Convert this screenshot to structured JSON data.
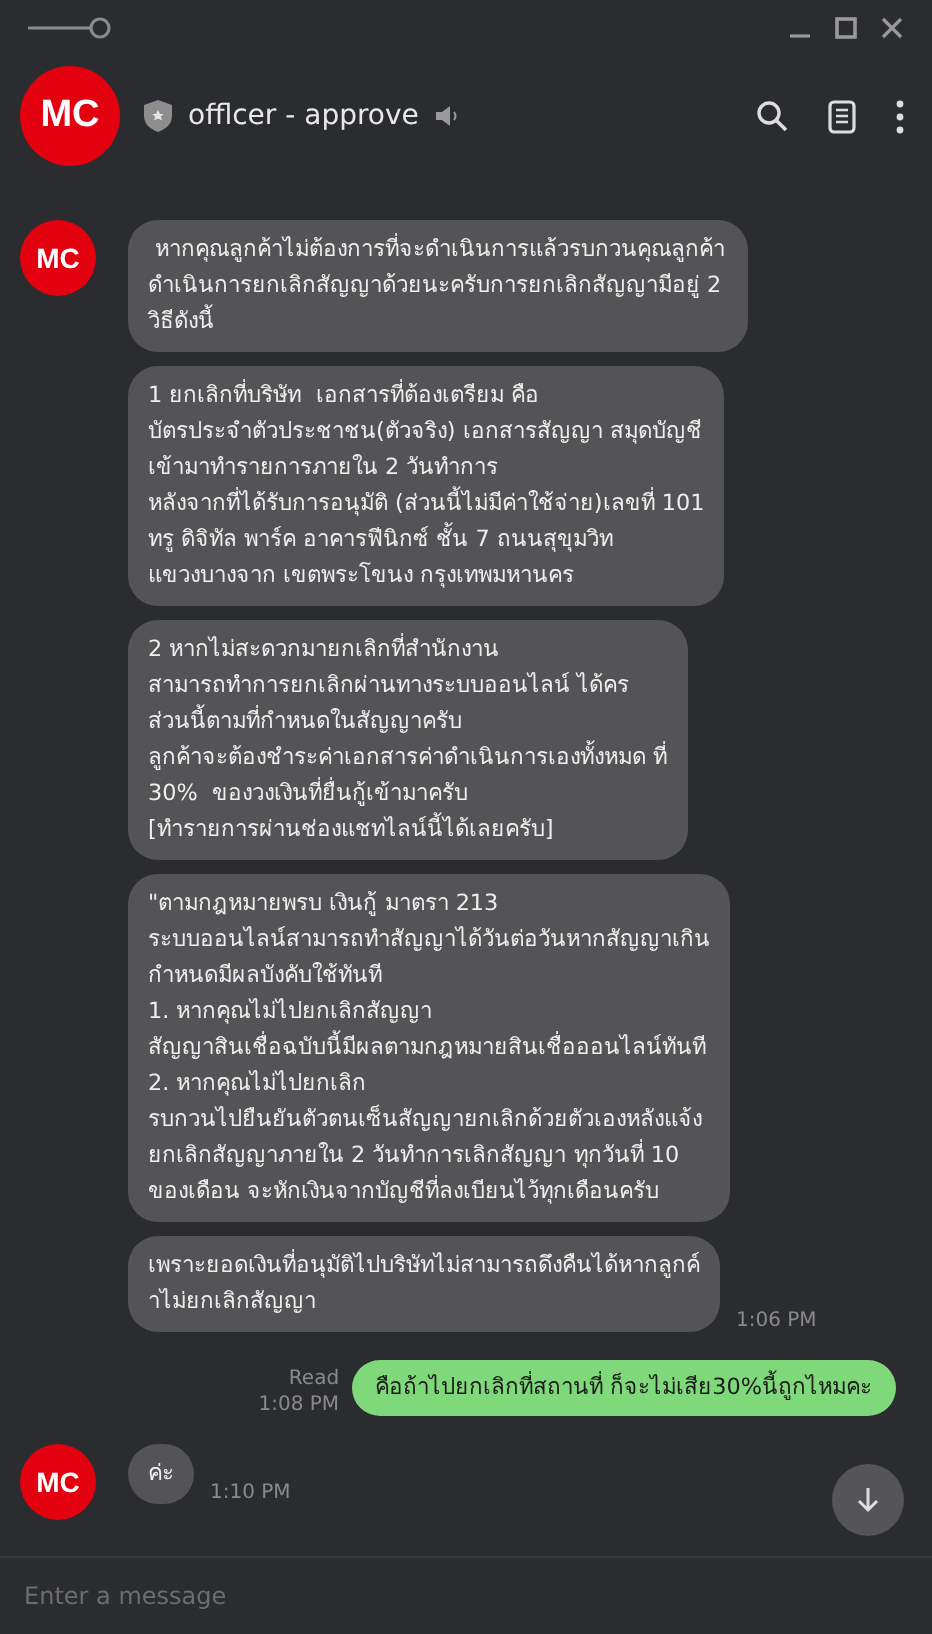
{
  "header": {
    "logo_text": "MC",
    "title": "offlcer - approve",
    "verified": true,
    "muted": true
  },
  "messages": [
    {
      "kind": "incoming",
      "avatar_text": "MC",
      "texts": [
        " หากคุณลูกค้าไม่ต้องการที่จะดำเนินการแล้วรบกวนคุณลูกค้าดำเนินการยกเลิกสัญญาด้วยนะครับการยกเลิกสัญญามีอยู่ 2 วิธีดังนี้",
        "1 ยกเลิกที่บริษัท  เอกสารที่ต้องเตรียม คือ\nบัตรประจำตัวประชาชน(ตัวจริง) เอกสารสัญญา สมุดบัญชี\nเข้ามาทำรายการภายใน 2 วันทำการ\nหลังจากที่ได้รับการอนุมัติ (ส่วนนี้ไม่มีค่าใช้จ่าย)เลขที่ 101\nทรู ดิจิทัล พาร์ค อาคารฟีนิกซ์ ชั้น 7 ถนนสุขุมวิท\nแขวงบางจาก เขตพระโขนง กรุงเทพมหานคร",
        "2 หากไม่สะดวกมายกเลิกที่สำนักงาน\nสามารถทำการยกเลิกผ่านทางระบบออนไลน์ ได้คร\nส่วนนี้ตามที่กำหนดในสัญญาครับ\nลูกค้าจะต้องชำระค่าเอกสารค่าดำเนินการเองทั้งหมด ที่\n30%  ของวงเงินที่ยื่นกู้เข้ามาครับ\n[ทำรายการผ่านช่องแชทไลน์นี้ได้เลยครับ]",
        "\"ตามกฎหมายพรบ เงินกู้ มาตรา 213\nระบบออนไลน์สามารถทำสัญญาได้วันต่อวันหากสัญญาเกิน\nกำหนดมีผลบังคับใช้ทันที\n1. หากคุณไม่ไปยกเลิกสัญญา\nสัญญาสินเชื่อฉบับนี้มีผลตามกฎหมายสินเชื่อออนไลน์ทันที\n2. หากคุณไม่ไปยกเลิก\nรบกวนไปยืนยันตัวตนเซ็นสัญญายกเลิกด้วยตัวเองหลังแจ้ง\nยกเลิกสัญญาภายใน 2 วันทำการเลิกสัญญา ทุกวันที่ 10\nของเดือน จะหักเงินจากบัญชีที่ลงเบียนไว้ทุกเดือนครับ",
        "เพราะยอดเงินที่อนุมัติไปบริษัทไม่สามารถดึงคืนได้หากลูกค์\nาไม่ยกเลิกสัญญา"
      ],
      "time": "1:06 PM"
    },
    {
      "kind": "outgoing",
      "read": "Read",
      "texts": [
        "คือถ้าไปยกเลิกที่สถานที่ ก็จะไม่เสีย30%นี้ถูกไหมคะ"
      ],
      "time": "1:08 PM"
    },
    {
      "kind": "incoming",
      "avatar_text": "MC",
      "texts": [
        "ค่ะ"
      ],
      "time": "1:10 PM"
    }
  ],
  "input": {
    "placeholder": "Enter a message"
  }
}
